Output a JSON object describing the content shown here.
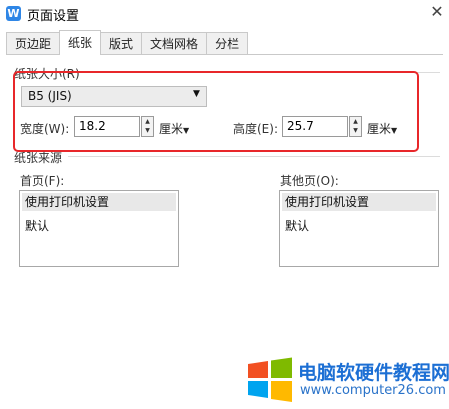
{
  "window": {
    "title": "页面设置",
    "app_icon_letter": "W",
    "close_label": "✕"
  },
  "tabs": [
    {
      "label": "页边距",
      "active": false
    },
    {
      "label": "纸张",
      "active": true
    },
    {
      "label": "版式",
      "active": false
    },
    {
      "label": "文档网格",
      "active": false
    },
    {
      "label": "分栏",
      "active": false
    }
  ],
  "paper_size": {
    "group_label": "纸张大小(R)",
    "selected": "B5 (JIS)",
    "width_label": "宽度(W):",
    "width_value": "18.2",
    "width_unit": "厘米",
    "height_label": "高度(E):",
    "height_value": "25.7",
    "height_unit": "厘米"
  },
  "paper_source": {
    "group_label": "纸张来源",
    "first_page_label": "首页(F):",
    "first_page_items": [
      "使用打印机设置",
      "默认"
    ],
    "other_pages_label": "其他页(O):",
    "other_pages_items": [
      "使用打印机设置",
      "默认"
    ]
  },
  "watermark": {
    "site_name": "电脑软硬件教程网",
    "site_url": "www.computer26.com"
  },
  "colors": {
    "annotation_red": "#e8272a",
    "accent_blue": "#2f86e6",
    "watermark_blue": "#1c6fd4"
  }
}
